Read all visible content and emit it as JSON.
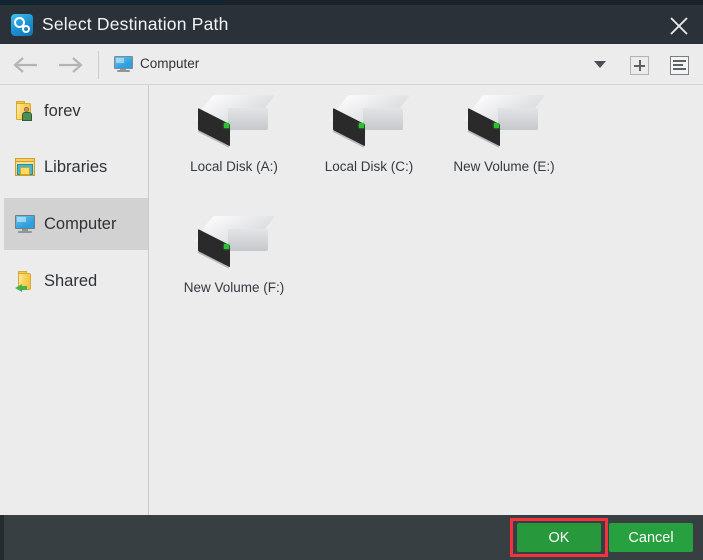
{
  "window": {
    "title": "Select Destination Path",
    "app_icon": "settings-gear-icon",
    "close_icon": "close-icon",
    "accent_color": "#27a03f",
    "titlebar_color": "#2b3138",
    "highlight_color": "#f5333f"
  },
  "navbar": {
    "back_icon": "arrow-left-icon",
    "forward_icon": "arrow-right-icon",
    "location_icon": "computer-monitor-icon",
    "location": "Computer",
    "dropdown_icon": "chevron-down-icon",
    "new_folder_icon": "plus-icon",
    "view_mode_icon": "list-view-icon"
  },
  "sidebar": {
    "items": [
      {
        "label": "forev",
        "icon": "user-folder-icon",
        "selected": false
      },
      {
        "label": "Libraries",
        "icon": "libraries-icon",
        "selected": false
      },
      {
        "label": "Computer",
        "icon": "computer-monitor-icon",
        "selected": true
      },
      {
        "label": "Shared",
        "icon": "shared-folder-icon",
        "selected": false
      }
    ]
  },
  "content": {
    "drives": [
      {
        "label": "Local Disk (A:)",
        "icon": "hard-drive-icon"
      },
      {
        "label": "Local Disk (C:)",
        "icon": "hard-drive-icon"
      },
      {
        "label": "New Volume (E:)",
        "icon": "hard-drive-icon"
      },
      {
        "label": "New Volume (F:)",
        "icon": "hard-drive-icon"
      }
    ]
  },
  "footer": {
    "ok_label": "OK",
    "cancel_label": "Cancel"
  }
}
